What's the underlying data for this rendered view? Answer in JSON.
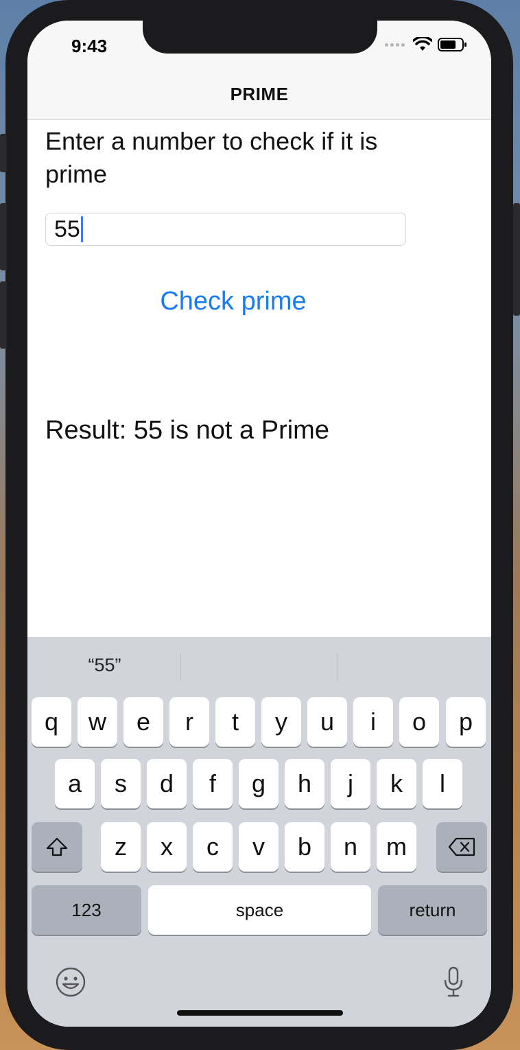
{
  "status_bar": {
    "time": "9:43"
  },
  "navbar": {
    "title": "PRIME"
  },
  "content": {
    "prompt": "Enter a number to check if it is prime",
    "input_value": "55",
    "check_button_label": "Check prime",
    "result_text": "Result: 55 is not a Prime"
  },
  "keyboard": {
    "suggestions": [
      "“55”",
      "",
      ""
    ],
    "row1": [
      "q",
      "w",
      "e",
      "r",
      "t",
      "y",
      "u",
      "i",
      "o",
      "p"
    ],
    "row2": [
      "a",
      "s",
      "d",
      "f",
      "g",
      "h",
      "j",
      "k",
      "l"
    ],
    "row3": [
      "z",
      "x",
      "c",
      "v",
      "b",
      "n",
      "m"
    ],
    "numbers_label": "123",
    "space_label": "space",
    "return_label": "return",
    "icons": [
      "shift-icon",
      "delete-icon",
      "emoji-icon",
      "microphone-icon"
    ]
  },
  "colors": {
    "accent": "#1a7cf0",
    "keyboard_bg": "#d1d4db"
  }
}
